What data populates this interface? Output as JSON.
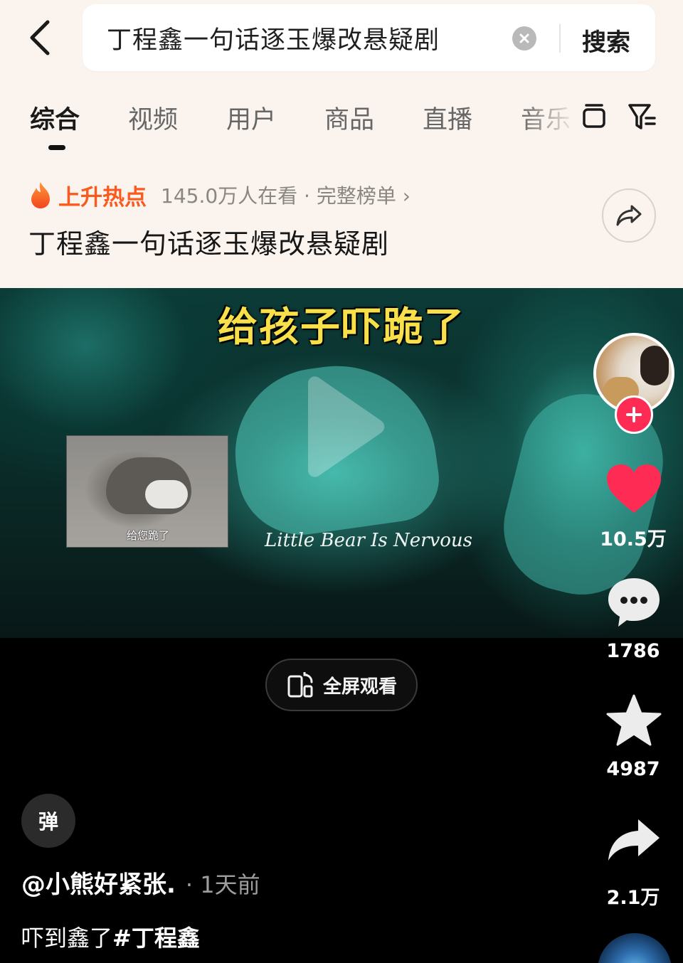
{
  "search": {
    "query": "丁程鑫一句话逐玉爆改悬疑剧",
    "submit_label": "搜索"
  },
  "tabs": [
    {
      "label": "综合",
      "active": true
    },
    {
      "label": "视频",
      "active": false
    },
    {
      "label": "用户",
      "active": false
    },
    {
      "label": "商品",
      "active": false
    },
    {
      "label": "直播",
      "active": false
    },
    {
      "label": "音乐",
      "active": false
    }
  ],
  "hot": {
    "tag": "上升热点",
    "meta": "145.0万人在看 · 完整榜单 ›",
    "title": "丁程鑫一句话逐玉爆改悬疑剧"
  },
  "video": {
    "caption": "给孩子吓跪了",
    "overlay_caption": "给您跪了",
    "watermark": "Little Bear Is Nervous",
    "fullscreen_label": "全屏观看"
  },
  "actions": {
    "likes": "10.5万",
    "comments": "1786",
    "favorites": "4987",
    "shares": "2.1万"
  },
  "post": {
    "danmu_label": "弹",
    "author": "@小熊好紧张.",
    "time": "· 1天前",
    "caption_text": "吓到鑫了",
    "caption_tag": "#丁程鑫"
  },
  "colors": {
    "accent_red": "#fe2c55",
    "hot_orange": "#fa5a1e",
    "header_bg": "#fbf4ee",
    "caption_yellow": "#f7e04a"
  }
}
